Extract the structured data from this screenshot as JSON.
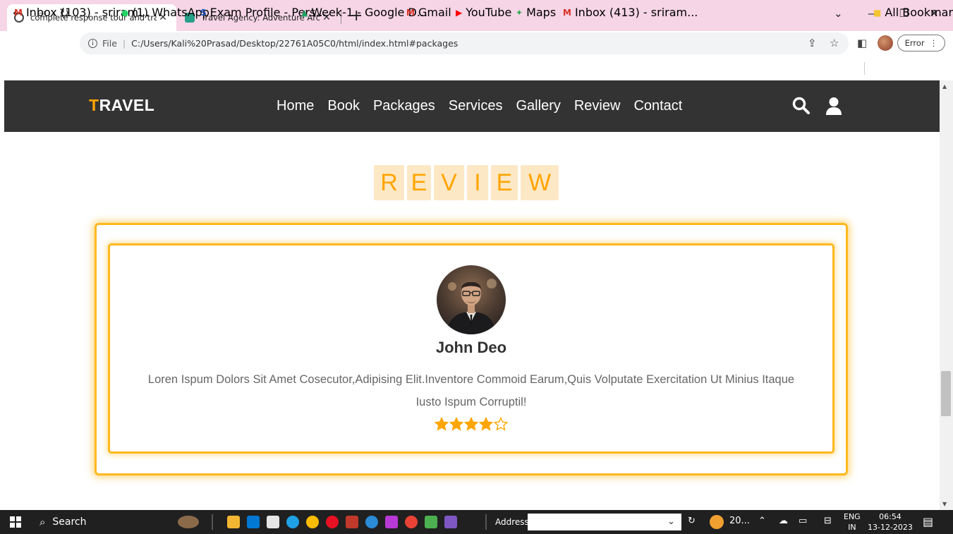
{
  "browser": {
    "tabs": [
      {
        "title": "complete response tour and tra",
        "active": true
      },
      {
        "title": "Travel Agency: Adventure Archit",
        "active": false
      }
    ],
    "address": {
      "file_label": "File",
      "url": "C:/Users/Kali%20Prasad/Desktop/22761A05C0/html/index.html#packages"
    },
    "error_label": "Error",
    "bookmarks": [
      {
        "label": "Inbox (103) - sriram...",
        "icon": "gmail-icon",
        "color": "#d93025"
      },
      {
        "label": "(1) WhatsApp",
        "icon": "whatsapp-icon",
        "color": "#25d366"
      },
      {
        "label": "Exam Profile - Pers...",
        "icon": "s-icon",
        "color": "#1a56c4"
      },
      {
        "label": "Week-1 - Google D...",
        "icon": "drive-icon",
        "color": "#1fa463"
      },
      {
        "label": "Gmail",
        "icon": "gmail-icon",
        "color": "#d93025"
      },
      {
        "label": "YouTube",
        "icon": "youtube-icon",
        "color": "#ff0000"
      },
      {
        "label": "Maps",
        "icon": "maps-icon",
        "color": "#34a853"
      },
      {
        "label": "Inbox (413) - sriram...",
        "icon": "gmail-icon",
        "color": "#d93025"
      }
    ],
    "all_bookmarks": "All Bookmarks"
  },
  "site": {
    "logo_first": "T",
    "logo_rest": "RAVEL",
    "nav": [
      "Home",
      "Book",
      "Packages",
      "Services",
      "Gallery",
      "Review",
      "Contact"
    ],
    "accent_color": "#ffa500",
    "header_color": "#333333"
  },
  "review_section": {
    "heading_letters": [
      "R",
      "E",
      "V",
      "I",
      "E",
      "W"
    ],
    "reviewer_name": "John Deo",
    "text": "Loren Ispum Dolors Sit Amet Cosecutor,Adipising Elit.Inventore Commoid Earum,Quis Volputate Exercitation Ut Minius Itaque Iusto Ispum Corruptil!",
    "rating": 4,
    "rating_max": 5
  },
  "taskbar": {
    "search_label": "Search",
    "address_label": "Address",
    "weather": "20...",
    "lang_top": "ENG",
    "lang_bottom": "IN",
    "time": "06:54",
    "date": "13-12-2023"
  }
}
